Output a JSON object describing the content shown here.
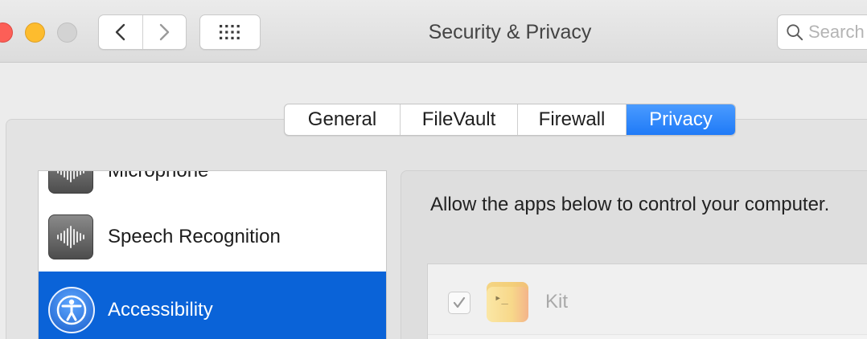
{
  "window": {
    "title": "Security & Privacy"
  },
  "toolbar": {
    "back_icon": "chevron-left-icon",
    "forward_icon": "chevron-right-icon",
    "show_all_icon": "grid-icon",
    "search_placeholder": "Search"
  },
  "tabs": [
    {
      "label": "General",
      "active": false
    },
    {
      "label": "FileVault",
      "active": false
    },
    {
      "label": "Firewall",
      "active": false
    },
    {
      "label": "Privacy",
      "active": true
    }
  ],
  "sidebar": {
    "items": [
      {
        "label": "Microphone",
        "icon": "waveform-icon",
        "selected": false
      },
      {
        "label": "Speech Recognition",
        "icon": "waveform-icon",
        "selected": true
      },
      {
        "label": "Accessibility",
        "icon": "accessibility-icon",
        "selected": true
      }
    ]
  },
  "main": {
    "description": "Allow the apps below to control your computer.",
    "apps": [
      {
        "name": "Kit",
        "checked": true,
        "icon": "terminal-app-icon"
      }
    ]
  },
  "colors": {
    "accent": "#1f7af7",
    "selection": "#0a63d8",
    "close": "#fc5f57",
    "minimize": "#fdbc2e"
  }
}
